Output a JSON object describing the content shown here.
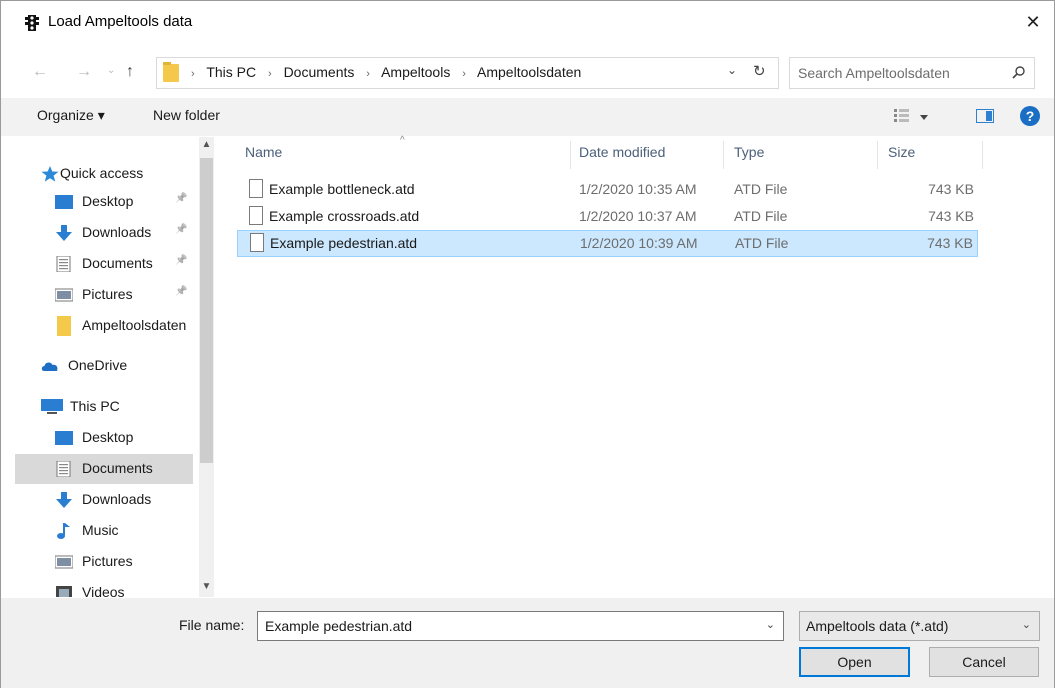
{
  "window": {
    "title": "Load Ampeltools data",
    "close_glyph": "✕"
  },
  "address": {
    "crumbs": [
      "This PC",
      "Documents",
      "Ampeltools",
      "Ampeltoolsdaten"
    ],
    "separator": "›",
    "lead_separator": "›",
    "search_placeholder": "Search Ampeltoolsdaten"
  },
  "nav_buttons": {
    "back": "←",
    "forward": "→",
    "recent": "⌄",
    "up": "↑",
    "dropdown": "⌄",
    "refresh": "↻"
  },
  "toolbar": {
    "organize_label": "Organize ▾",
    "new_folder_label": "New folder",
    "help_label": "?"
  },
  "sidebar": {
    "quick_access": "Quick access",
    "items_quick": [
      {
        "label": "Desktop",
        "icon": "desktop-icon",
        "pinned": true
      },
      {
        "label": "Downloads",
        "icon": "downloads-icon",
        "pinned": true
      },
      {
        "label": "Documents",
        "icon": "documents-icon",
        "pinned": true
      },
      {
        "label": "Pictures",
        "icon": "pictures-icon",
        "pinned": true
      },
      {
        "label": "Ampeltoolsdaten",
        "icon": "folder-icon",
        "pinned": false
      }
    ],
    "onedrive": "OneDrive",
    "this_pc": "This PC",
    "items_pc": [
      {
        "label": "Desktop",
        "icon": "desktop-icon"
      },
      {
        "label": "Documents",
        "icon": "documents-icon",
        "selected": true
      },
      {
        "label": "Downloads",
        "icon": "downloads-icon"
      },
      {
        "label": "Music",
        "icon": "music-icon"
      },
      {
        "label": "Pictures",
        "icon": "pictures-icon"
      },
      {
        "label": "Videos",
        "icon": "videos-icon"
      }
    ],
    "pin_glyph": "📌"
  },
  "file_list": {
    "columns": [
      "Name",
      "Date modified",
      "Type",
      "Size"
    ],
    "rows": [
      {
        "name": "Example bottleneck.atd",
        "date": "1/2/2020 10:35 AM",
        "type": "ATD File",
        "size": "743 KB",
        "selected": false
      },
      {
        "name": "Example crossroads.atd",
        "date": "1/2/2020 10:37 AM",
        "type": "ATD File",
        "size": "743 KB",
        "selected": false
      },
      {
        "name": "Example pedestrian.atd",
        "date": "1/2/2020 10:39 AM",
        "type": "ATD File",
        "size": "743 KB",
        "selected": true
      }
    ]
  },
  "footer": {
    "file_name_label": "File name:",
    "file_name_value": "Example pedestrian.atd",
    "file_type_value": "Ampeltools data (*.atd)",
    "open_label": "Open",
    "cancel_label": "Cancel"
  },
  "colors": {
    "selection": "#cce8ff",
    "accent": "#0078d7",
    "folder": "#f4c84a"
  }
}
